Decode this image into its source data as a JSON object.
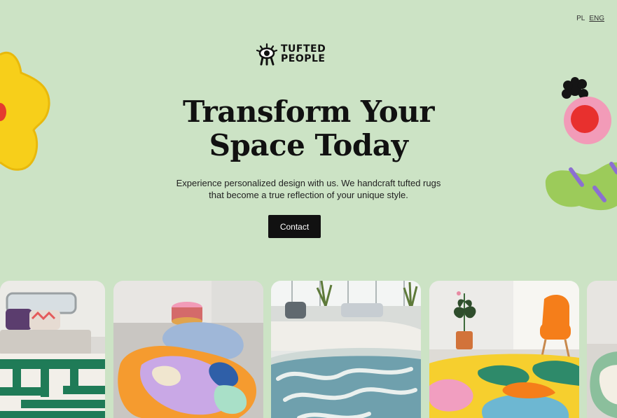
{
  "lang": {
    "options": [
      "PL",
      "ENG"
    ],
    "active": "ENG"
  },
  "brand": {
    "line1": "TUFTED",
    "line2": "PEOPLE"
  },
  "hero": {
    "headline_line1": "Transform Your",
    "headline_line2": "Space Today",
    "sub_line1": "Experience personalized design with us. We handcraft tufted rugs",
    "sub_line2": "that become a true reflection of your unique style.",
    "cta_label": "Contact"
  },
  "colors": {
    "background": "#cce3c5",
    "button": "#111111",
    "button_text": "#ffffff"
  },
  "gallery": {
    "items": [
      "rug-photo-camper-van",
      "rug-photo-pastel-loft",
      "rug-photo-living-room",
      "rug-photo-orange-chair",
      "rug-photo-partial"
    ]
  }
}
